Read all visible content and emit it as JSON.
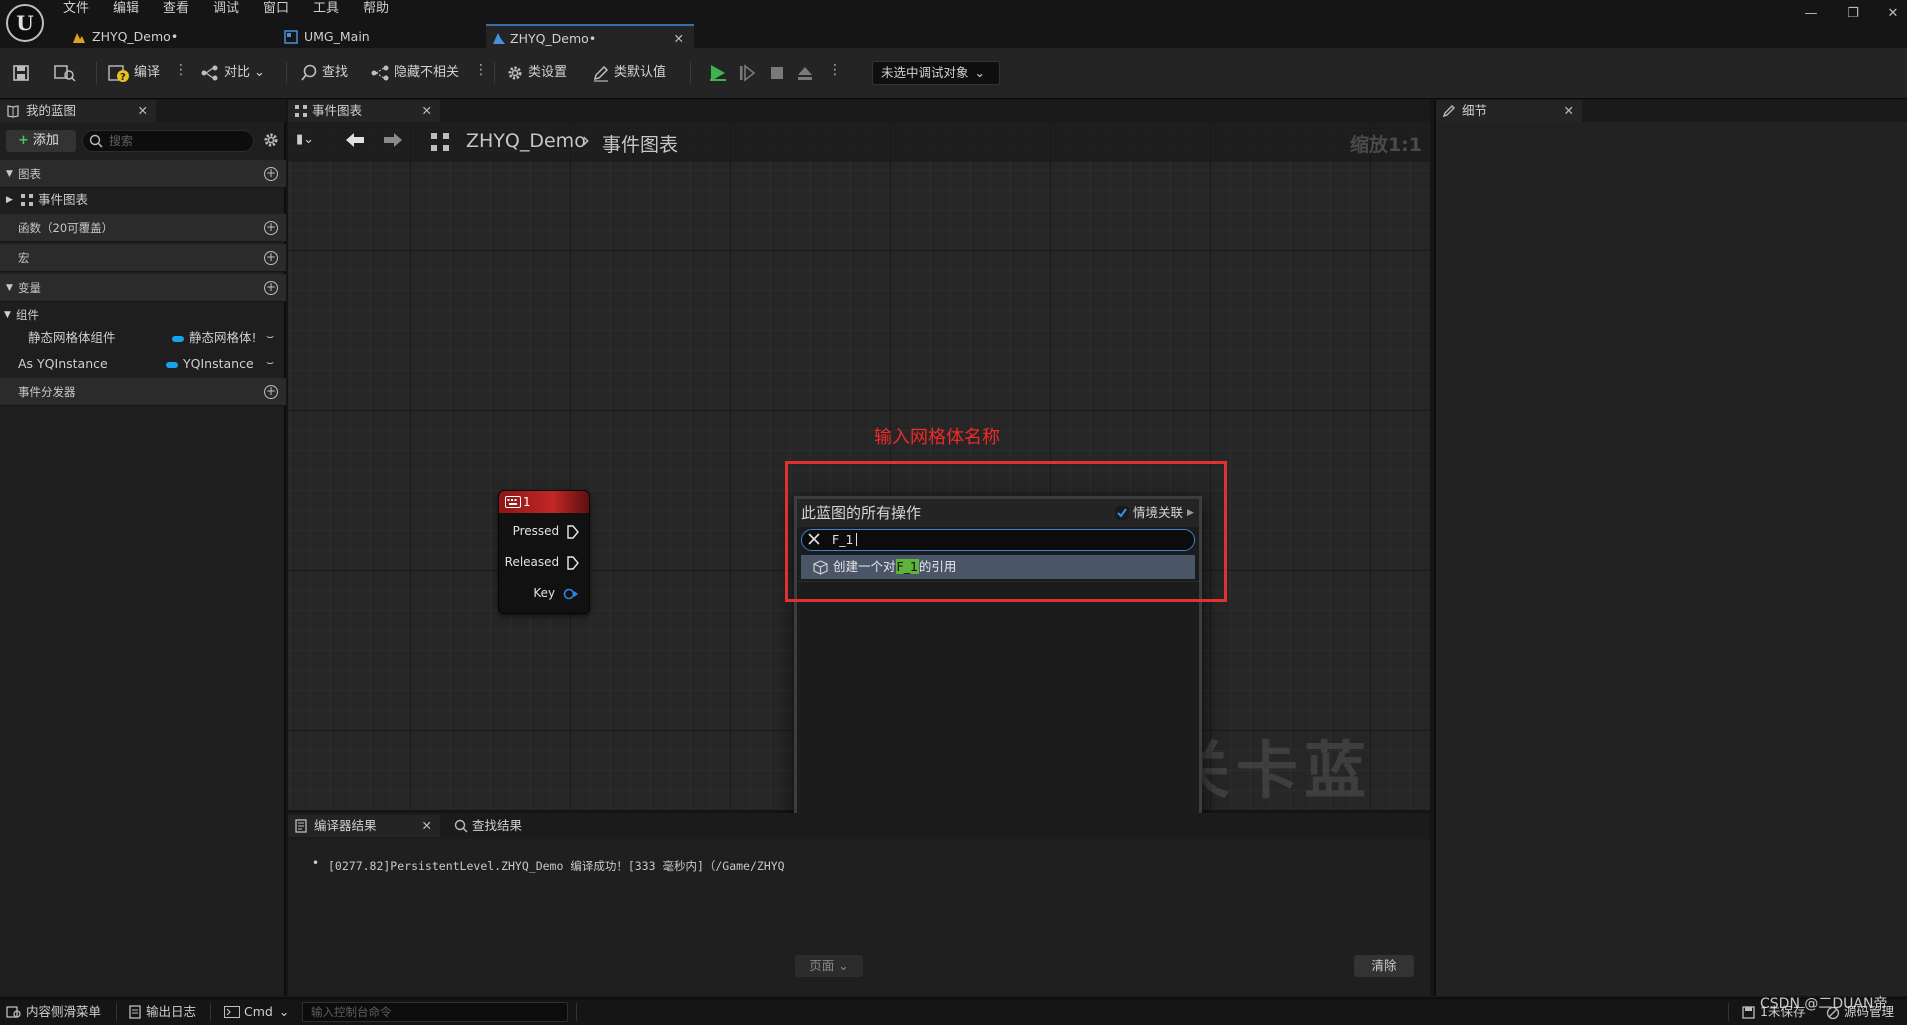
{
  "menu": [
    "文件",
    "编辑",
    "查看",
    "调试",
    "窗口",
    "工具",
    "帮助"
  ],
  "tabs": [
    {
      "label": "ZHYQ_Demo•"
    },
    {
      "label": "UMG_Main"
    },
    {
      "label": "ZHYQ_Demo•"
    }
  ],
  "toolbar": {
    "compile": "编译",
    "diff": "对比",
    "find": "查找",
    "hide_unrelated": "隐藏不相关",
    "class_settings": "类设置",
    "class_defaults": "类默认值",
    "debug_object": "未选中调试对象"
  },
  "left_panel": {
    "tab": "我的蓝图",
    "add_button": "添加",
    "search_placeholder": "搜索",
    "sections": {
      "graphs": "图表",
      "event_graph": "事件图表",
      "functions": "函数（20可覆盖）",
      "macros": "宏",
      "variables": "变量",
      "components": "组件",
      "dispatchers": "事件分发器"
    },
    "vars": [
      {
        "name": "静态网格体组件",
        "type": "静态网格体!"
      },
      {
        "name": "As YQInstance",
        "type": "YQInstance"
      }
    ]
  },
  "graph": {
    "tab": "事件图表",
    "breadcrumb_root": "ZHYQ_Demo",
    "breadcrumb_leaf": "事件图表",
    "zoom": "缩放1:1",
    "watermark": "关卡蓝图",
    "node": {
      "title": "1",
      "pins": [
        "Pressed",
        "Released",
        "Key"
      ]
    }
  },
  "context_menu": {
    "title": "此蓝图的所有操作",
    "context_sensitive_label": "情境关联",
    "search_value": "F_1",
    "result_prefix": "创建一个对",
    "result_highlight": "F_1",
    "result_suffix": "的引用"
  },
  "annotation": {
    "text": "输入网格体名称",
    "color": "#e03030"
  },
  "bottom": {
    "tab_compiler": "编译器结果",
    "tab_find": "查找结果",
    "log_line": "[0277.82]PersistentLevel.ZHYQ_Demo 编译成功！[333 毫秒内]（/Game/ZHYQ",
    "page_button": "页面",
    "clear_button": "清除"
  },
  "details": {
    "tab": "细节"
  },
  "statusbar": {
    "content_drawer": "内容侧滑菜单",
    "output_log": "输出日志",
    "cmd": "Cmd",
    "console_placeholder": "输入控制台命令",
    "unsaved": "1未保存",
    "source_control": "源码管理",
    "watermark": "CSDN @二DUAN帝"
  },
  "colors": {
    "accent": "#3d7fd0",
    "node_header": "#c22626",
    "play": "#3fb34f",
    "highlight": "#5fb33a"
  }
}
